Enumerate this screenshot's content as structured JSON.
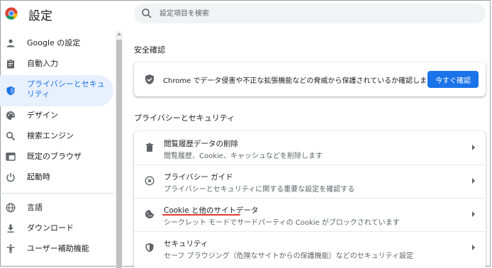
{
  "app": {
    "title": "設定"
  },
  "search": {
    "placeholder": "設定項目を検索"
  },
  "sidebar": {
    "items": [
      {
        "label": "Google の設定",
        "icon": "person-icon"
      },
      {
        "label": "自動入力",
        "icon": "clipboard-icon"
      },
      {
        "label": "プライバシーとセキュリティ",
        "icon": "shield-icon",
        "active": true
      },
      {
        "label": "デザイン",
        "icon": "palette-icon"
      },
      {
        "label": "検索エンジン",
        "icon": "search-icon"
      },
      {
        "label": "既定のブラウザ",
        "icon": "browser-icon"
      },
      {
        "label": "起動時",
        "icon": "power-icon"
      },
      {
        "label": "言語",
        "icon": "globe-icon"
      },
      {
        "label": "ダウンロード",
        "icon": "download-icon"
      },
      {
        "label": "ユーザー補助機能",
        "icon": "accessibility-icon"
      }
    ]
  },
  "safety_check": {
    "heading": "安全確認",
    "text": "Chrome でデータ侵害や不正な拡張機能などの脅威から保護されているか確認します",
    "button_label": "今すぐ確認"
  },
  "privacy": {
    "heading": "プライバシーとセキュリティ",
    "rows": [
      {
        "title": "閲覧履歴データの削除",
        "subtitle": "閲覧履歴、Cookie、キャッシュなどを削除します",
        "icon": "trash-icon"
      },
      {
        "title": "プライバシー ガイド",
        "subtitle": "プライバシーとセキュリティに関する重要な設定を確認する",
        "icon": "compass-icon"
      },
      {
        "title": "Cookie と他のサイトデータ",
        "subtitle": "シークレット モードでサードパーティの Cookie がブロックされています",
        "icon": "cookie-icon"
      },
      {
        "title": "セキュリティ",
        "subtitle": "セーフ ブラウジング（危険なサイトからの保護機能）などのセキュリティ設定",
        "icon": "shield-icon"
      }
    ]
  },
  "colors": {
    "accent": "#1a73e8",
    "active_bg": "#e8f0fe",
    "highlight_underline": "#e53935"
  }
}
